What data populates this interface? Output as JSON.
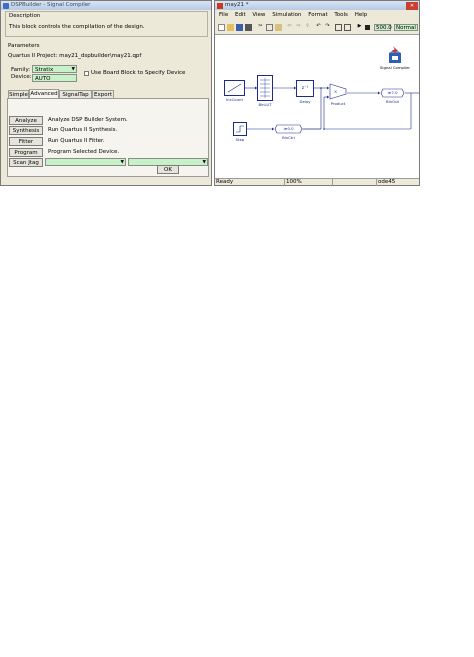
{
  "dialog": {
    "title": "DSPBuilder - Signal Compiler",
    "description_heading": "Description",
    "description_text": "This block controls the compilation of the design.",
    "parameters_heading": "Parameters",
    "project_label": "Quartus II Project: may21_dspbuilder\\may21.qpf",
    "family_label": "Family:",
    "family_value": "Stratix",
    "device_label": "Device:",
    "device_value": "AUTO",
    "board_checkbox_label": "Use Board Block to Specify Device",
    "tabs": [
      "Simple",
      "Advanced",
      "SignalTap II",
      "Export"
    ],
    "active_tab": "Advanced",
    "actions": [
      {
        "button": "Analyze",
        "desc": "Analyze DSP Builder System."
      },
      {
        "button": "Synthesis",
        "desc": "Run Quartus II Synthesis."
      },
      {
        "button": "Fitter",
        "desc": "Run Quartus II Fitter."
      },
      {
        "button": "Program",
        "desc": "Program Selected Device."
      }
    ],
    "scan_jtag_label": "Scan Jtag",
    "ok_label": "OK"
  },
  "model_window": {
    "title": "may21 *",
    "menu": [
      "File",
      "Edit",
      "View",
      "Simulation",
      "Format",
      "Tools",
      "Help"
    ],
    "sim_time": "500.0",
    "sim_mode": "Normal",
    "status": {
      "left": "Ready",
      "zoom": "100%",
      "solver": "ode45"
    },
    "blocks": {
      "incount": "IncCount",
      "binlut": "BinLUT",
      "delay": "Delay",
      "delay_expr": "z⁻¹",
      "product": "Product",
      "binout": "BinOut",
      "binout_text": "≫7.0",
      "step": "Step",
      "binctrl": "BinCtrl",
      "binctrl_text": "≫0.0",
      "signal_compiler": "Signal Compiler"
    }
  },
  "colors": {
    "combo_green": "#c7f2c7",
    "block_blue": "#1c2b8c",
    "canvas": "#ffffff"
  }
}
